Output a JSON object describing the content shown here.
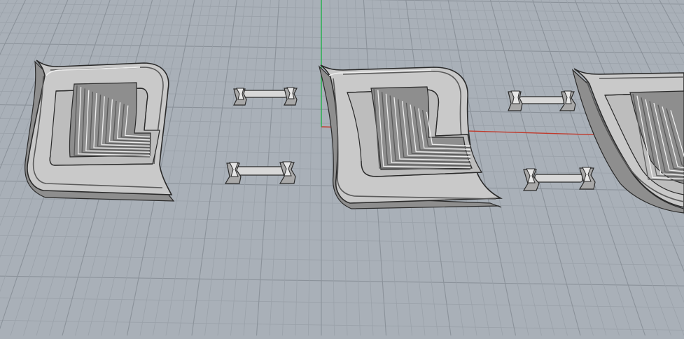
{
  "viewport": {
    "background": "#a9b0b8",
    "grid_minor_color": "#9aa1a9",
    "grid_major_color": "#8b929a",
    "x_axis_color": "#c0392b",
    "y_axis_color": "#22b24c"
  },
  "materials": {
    "part_face": "#c9c9c9",
    "part_side": "#8e8e8e",
    "part_edge": "#2a2a2a",
    "groove": "#5a5a5a",
    "highlight": "#eeeeee"
  },
  "objects": [
    {
      "name": "trim-panel-1",
      "kind": "trim-panel"
    },
    {
      "name": "trim-panel-2",
      "kind": "trim-panel"
    },
    {
      "name": "trim-panel-3",
      "kind": "trim-panel",
      "partial": true
    },
    {
      "name": "clip-1",
      "kind": "clip"
    },
    {
      "name": "clip-2",
      "kind": "clip"
    },
    {
      "name": "clip-3",
      "kind": "clip"
    },
    {
      "name": "clip-4",
      "kind": "clip"
    }
  ]
}
